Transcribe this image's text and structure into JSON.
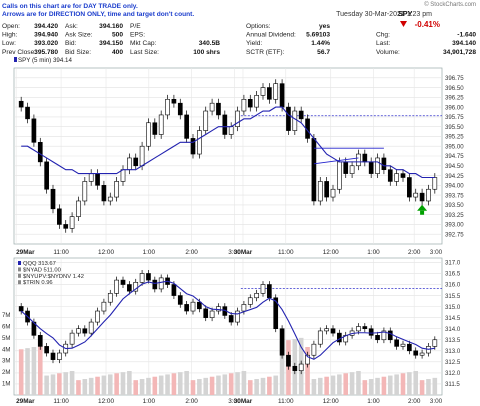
{
  "note": {
    "line1": "Calls on this chart are for DAY TRADE only.",
    "line2": "Arrows are for DIRECTION ONLY, time and target don't count."
  },
  "watermark": "© StockCharts.com",
  "header": {
    "date": "Tuesday 30-Mar-2021 1:23 pm",
    "symbol": "SPY",
    "pct_change": "-0.41%",
    "quote_left": [
      {
        "label": "Open:",
        "value": "394.420"
      },
      {
        "label": "High:",
        "value": "394.940"
      },
      {
        "label": "Low:",
        "value": "393.020"
      },
      {
        "label": "Prev Close:",
        "value": "395.780"
      }
    ],
    "quote_mid": [
      {
        "label": "Ask:",
        "value": "394.160"
      },
      {
        "label": "Ask Size:",
        "value": "500"
      },
      {
        "label": "Bid:",
        "value": "394.150"
      },
      {
        "label": "Bid Size:",
        "value": "400"
      }
    ],
    "quote_mid2": [
      {
        "label": "P/E",
        "value": ""
      },
      {
        "label": "EPS:",
        "value": ""
      },
      {
        "label": "Mkt Cap:",
        "value": "340.5B"
      },
      {
        "label": "Last Size:",
        "value": "100 shrs"
      }
    ],
    "quote_right": [
      {
        "label": "Options:",
        "value": "yes"
      },
      {
        "label": "Annual Dividend:",
        "value": "5.69103"
      },
      {
        "label": "Yield:",
        "value": "1.44%"
      },
      {
        "label": "SCTR (ETF):",
        "value": "56.7"
      }
    ],
    "quote_far": [
      {
        "label": "Chg:",
        "value": "-1.640"
      },
      {
        "label": "Last:",
        "value": "394.140"
      },
      {
        "label": "Volume:",
        "value": "34,901,728"
      }
    ]
  },
  "colors": {
    "up": "#00a000",
    "down": "#d00000",
    "ma": "#2323b0",
    "line": "#6060e0",
    "up_candle": "#ffffff",
    "down_candle": "#000000"
  },
  "chart_data": [
    {
      "type": "candlestick",
      "legend": "SPY (5 min) 394.14",
      "ylim": [
        392.5,
        397.0
      ],
      "yticks": [
        "392.75",
        "393.00",
        "393.25",
        "393.50",
        "393.75",
        "394.00",
        "394.25",
        "394.50",
        "394.75",
        "395.00",
        "395.25",
        "395.50",
        "395.75",
        "396.00",
        "396.25",
        "396.50",
        "396.75"
      ],
      "x_ticks": [
        "29Mar",
        "11:00",
        "12:00",
        "1:00",
        "2:00",
        "3:00",
        "30Mar",
        "11:00",
        "12:00",
        "1:00",
        "2:00",
        "3:00"
      ],
      "close": [
        396.0,
        395.7,
        395.1,
        394.6,
        393.9,
        393.4,
        393.0,
        392.9,
        393.2,
        393.6,
        394.1,
        394.3,
        394.0,
        393.6,
        393.7,
        394.1,
        394.4,
        394.7,
        394.5,
        395.0,
        395.6,
        395.3,
        395.8,
        396.2,
        396.1,
        395.8,
        395.2,
        394.8,
        395.4,
        395.9,
        396.1,
        395.8,
        395.3,
        395.5,
        395.9,
        396.2,
        396.0,
        396.3,
        396.5,
        396.2,
        396.6,
        396.0,
        395.4,
        395.9,
        395.7,
        395.2,
        393.6,
        394.1,
        393.7,
        393.9,
        394.6,
        394.3,
        394.5,
        394.8,
        394.6,
        394.3,
        394.7,
        394.4,
        394.1,
        394.3,
        394.2,
        393.7,
        393.8,
        393.6,
        393.9,
        394.2
      ],
      "ma_slow": [
        395.0,
        395.0,
        394.9,
        394.8,
        394.7,
        394.6,
        394.5,
        394.4,
        394.4,
        394.3,
        394.3,
        394.3,
        394.3,
        394.3,
        394.3,
        394.3,
        394.4,
        394.4,
        394.4,
        394.5,
        394.6,
        394.7,
        394.8,
        394.9,
        395.0,
        395.1,
        395.1,
        395.1,
        395.2,
        395.3,
        395.4,
        395.5,
        395.5,
        395.5,
        395.6,
        395.7,
        395.7,
        395.8,
        395.9,
        395.9,
        396.0,
        396.0,
        395.8,
        395.7,
        395.6,
        395.4,
        395.2,
        395.0,
        394.8,
        394.7,
        394.6,
        394.6,
        394.6,
        394.6,
        394.6,
        394.6,
        394.6,
        394.5,
        394.5,
        394.4,
        394.4,
        394.3,
        394.3,
        394.2,
        394.2,
        394.2
      ],
      "level_line": 395.78,
      "channel_top": 394.95,
      "channel_bottom": [
        394.55,
        394.7
      ],
      "signal_arrow": "up"
    },
    {
      "type": "candlestick",
      "legend": [
        "QQQ 313.67",
        "$NYAD 511.00",
        "$NYUPV:$NYDNV 1.42",
        "$TRIN 0.96"
      ],
      "ylim": [
        311.0,
        317.2
      ],
      "yticks": [
        "311.5",
        "312.0",
        "312.5",
        "313.0",
        "313.5",
        "314.0",
        "314.5",
        "315.0",
        "315.5",
        "316.0",
        "316.5",
        "317.0"
      ],
      "volume_ticks": [
        "1M",
        "2M",
        "3M",
        "4M",
        "5M",
        "6M",
        "7M"
      ],
      "x_ticks": [
        "29Mar",
        "11:00",
        "12:00",
        "1:00",
        "2:00",
        "3:00",
        "30Mar",
        "11:00",
        "12:00",
        "1:00",
        "2:00",
        "3:00"
      ],
      "close": [
        314.8,
        314.3,
        313.7,
        313.2,
        312.9,
        312.6,
        312.9,
        313.3,
        313.8,
        314.0,
        313.8,
        314.3,
        314.8,
        315.2,
        315.6,
        316.2,
        316.0,
        315.7,
        316.1,
        316.5,
        316.2,
        315.8,
        316.3,
        316.0,
        315.5,
        315.1,
        314.8,
        315.2,
        314.9,
        314.5,
        314.8,
        315.0,
        314.6,
        314.3,
        314.8,
        315.1,
        315.4,
        315.6,
        316.0,
        315.4,
        314.0,
        312.8,
        312.3,
        312.1,
        312.4,
        312.8,
        313.3,
        313.9,
        314.0,
        313.8,
        313.4,
        313.7,
        313.9,
        314.1,
        314.0,
        313.7,
        313.5,
        313.9,
        313.5,
        313.2,
        313.3,
        313.0,
        312.8,
        312.9,
        313.2,
        313.5
      ],
      "level_line": 315.82
    }
  ]
}
